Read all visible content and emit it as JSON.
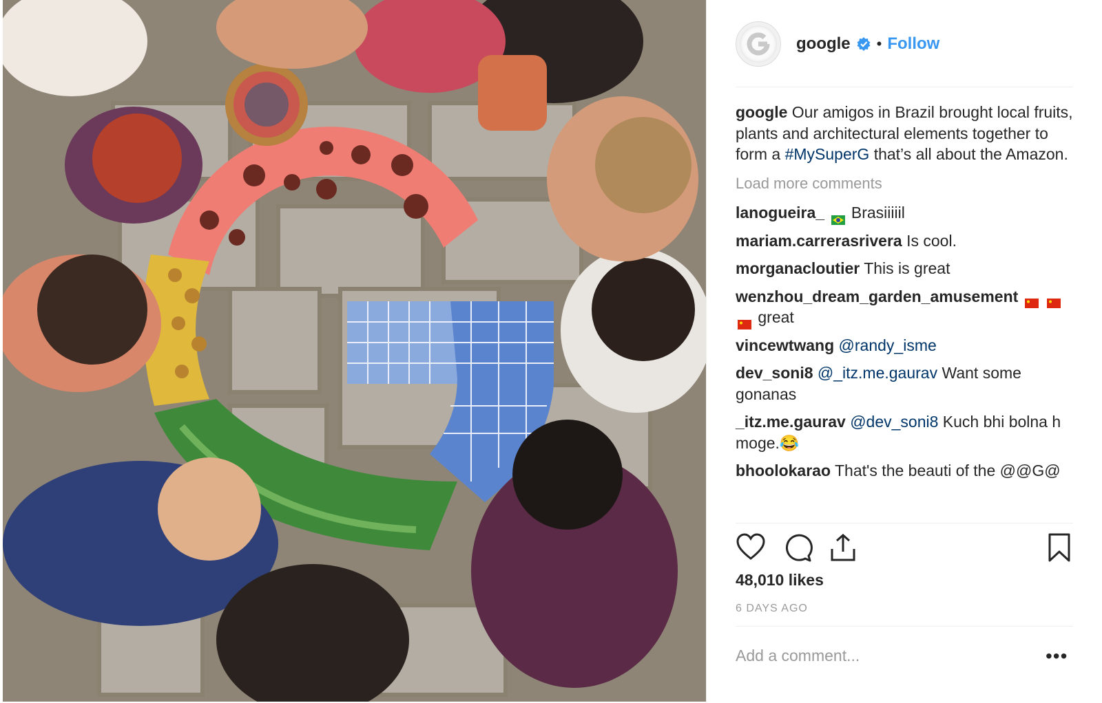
{
  "post": {
    "username": "google",
    "follow_label": "Follow",
    "separator": "•",
    "caption": {
      "username": "google",
      "text_before": "Our amigos in Brazil brought local fruits, plants and architectural elements together to form a",
      "hashtag": "#MySuperG",
      "text_after": "that’s all about the Amazon."
    },
    "load_more_label": "Load more comments",
    "comments": [
      {
        "user": "lanogueira_",
        "text": "Brasiiiiil"
      },
      {
        "user": "mariam.carrerasrivera",
        "text": "Is cool."
      },
      {
        "user": "morganacloutier",
        "text": "This is great"
      },
      {
        "user": "wenzhou_dream_garden_amusement",
        "text": "great"
      },
      {
        "user": "vincewtwang",
        "mention": "@randy_isme"
      },
      {
        "user": "dev_soni8",
        "mention": "@_itz.me.gaurav",
        "text": "Want some gonanas"
      },
      {
        "user": "_itz.me.gaurav",
        "mention": "@dev_soni8",
        "text": "Kuch bhi bolna h moge.😂"
      },
      {
        "user": "bhoolokarao",
        "text": "That's the beauti of the @@G@"
      }
    ],
    "likes_label": "48,010 likes",
    "age_label": "6 DAYS AGO",
    "add_comment_placeholder": "Add a comment...",
    "more_label": "•••"
  },
  "colors": {
    "accent_blue": "#3897f0",
    "hashtag_blue": "#003569",
    "muted_gray": "#999999",
    "text": "#262626"
  }
}
